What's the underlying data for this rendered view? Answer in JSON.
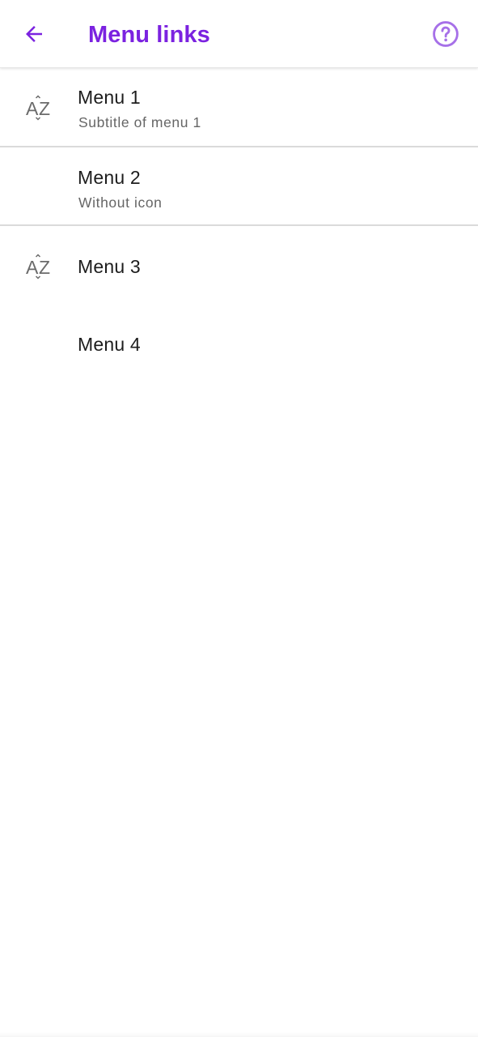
{
  "app_bar": {
    "title": "Menu links",
    "back_icon": "arrow-back-icon",
    "help_icon": "help-circle-icon",
    "accent_color": "#7b22e0",
    "help_icon_color": "#a670e8"
  },
  "menu": {
    "items": [
      {
        "label": "Menu 1",
        "subtitle": "Subtitle of menu 1",
        "icon": "sort-az-icon"
      },
      {
        "label": "Menu 2",
        "subtitle": "Without icon",
        "icon": ""
      },
      {
        "label": "Menu 3",
        "subtitle": "",
        "icon": "sort-az-icon"
      },
      {
        "label": "Menu 4",
        "subtitle": "",
        "icon": ""
      }
    ],
    "icon_color": "#6b6b6b"
  }
}
